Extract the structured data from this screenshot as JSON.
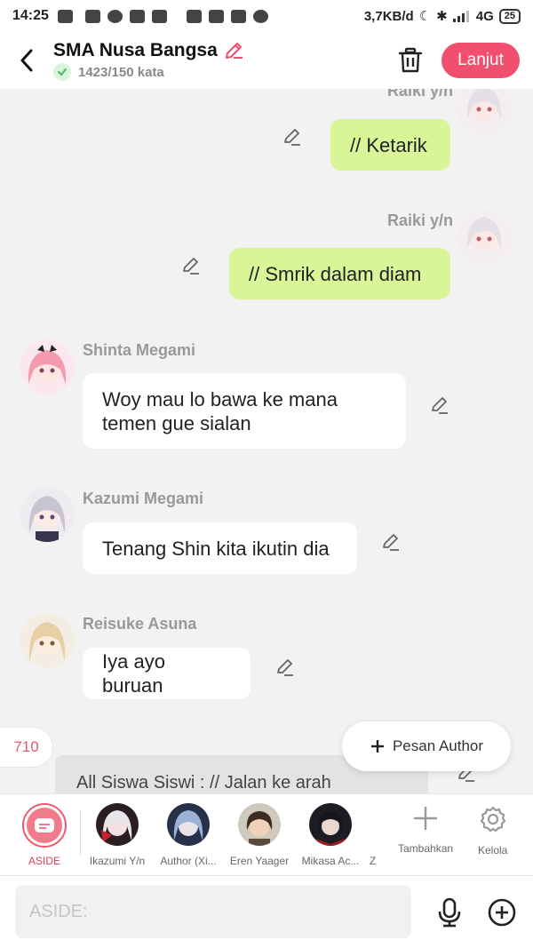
{
  "status_bar": {
    "time": "14:25",
    "network_speed": "3,7KB/d",
    "signal": "4G",
    "battery": "25",
    "battery_level": 0.25
  },
  "header": {
    "title": "SMA Nusa Bangsa",
    "word_count": "1423/150 kata",
    "next_label": "Lanjut",
    "accent_color": "#f0506e"
  },
  "messages": [
    {
      "side": "right",
      "name": "Raiki y/n",
      "text": "// Ketarik"
    },
    {
      "side": "right",
      "name": "Raiki y/n",
      "text": "// Smrik dalam diam"
    },
    {
      "side": "left",
      "name": "Shinta Megami",
      "text": "Woy mau lo bawa ke mana temen gue sialan"
    },
    {
      "side": "left",
      "name": "Kazumi Megami",
      "text": "Tenang Shin kita ikutin dia"
    },
    {
      "side": "left",
      "name": "Reisuke Asuna",
      "text": "Iya ayo buruan"
    }
  ],
  "aside_preview": "All Siswa Siswi : // Jalan ke arah lapangan",
  "message_count": "710",
  "author_button": "Pesan Author",
  "characters": [
    {
      "label": "ASIDE"
    },
    {
      "label": "Ikazumi Y/n"
    },
    {
      "label": "Author (Xi..."
    },
    {
      "label": "Eren Yaager"
    },
    {
      "label": "Mikasa Ac..."
    },
    {
      "label": "Z"
    }
  ],
  "tools": {
    "add_label": "Tambahkan",
    "manage_label": "Kelola"
  },
  "input": {
    "placeholder": "ASIDE:"
  }
}
